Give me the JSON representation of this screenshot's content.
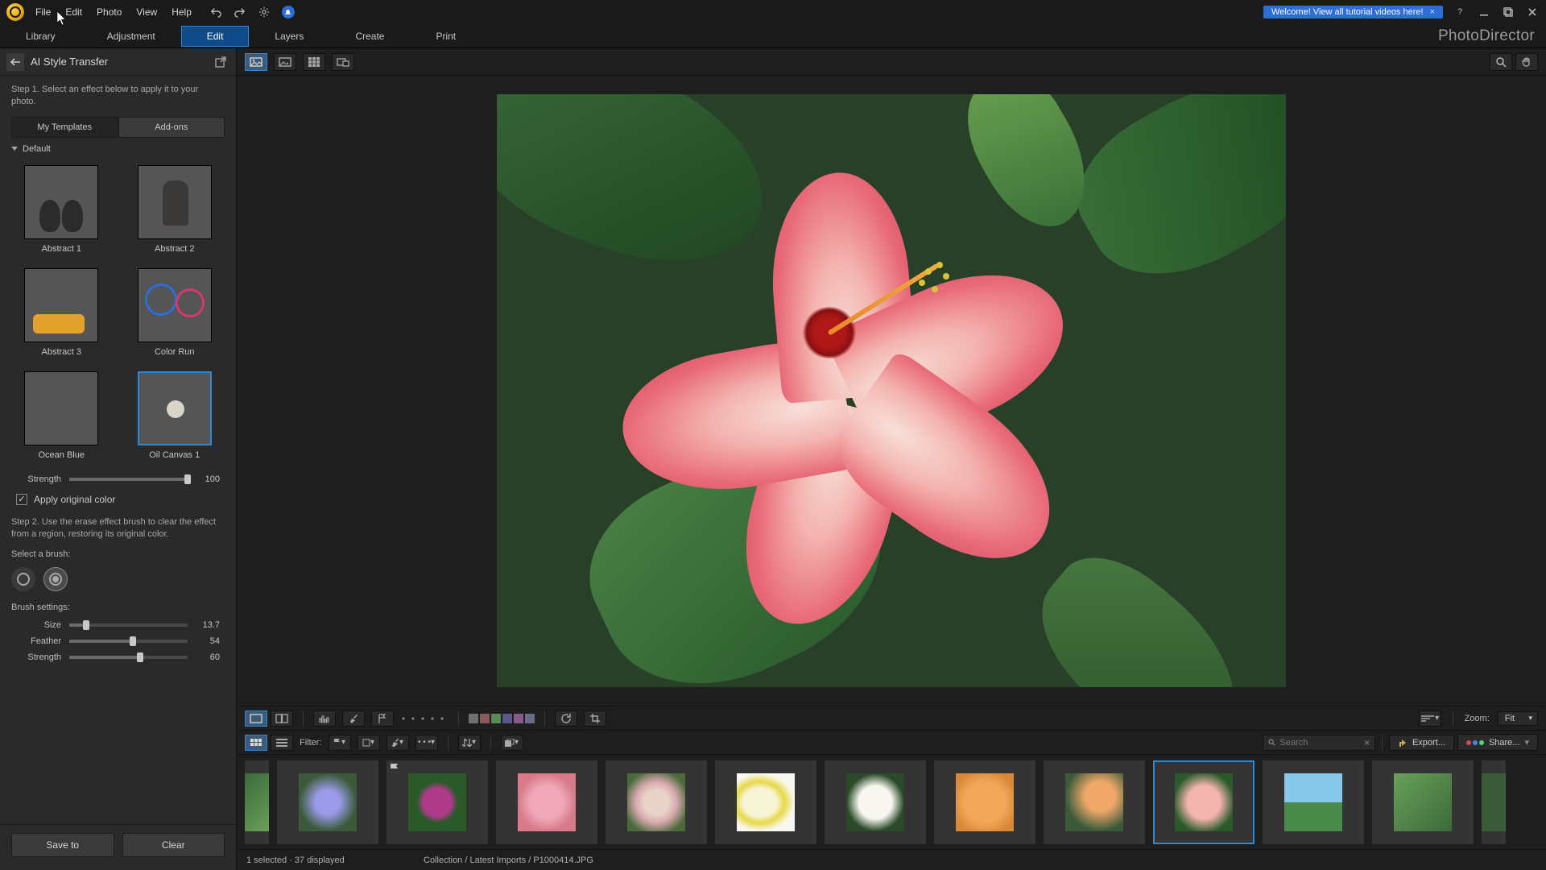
{
  "titlebar": {
    "menu": [
      "File",
      "Edit",
      "Photo",
      "View",
      "Help"
    ],
    "welcome_text": "Welcome! View all tutorial videos here!"
  },
  "mode_tabs": [
    "Library",
    "Adjustment",
    "Edit",
    "Layers",
    "Create",
    "Print"
  ],
  "mode_active": "Edit",
  "brand": "PhotoDirector",
  "sidebar": {
    "title": "AI Style Transfer",
    "step1": "Step 1. Select an effect below to apply it to your photo.",
    "template_tabs": [
      "My Templates",
      "Add-ons"
    ],
    "template_tab_active": "My Templates",
    "section": "Default",
    "templates": [
      {
        "label": "Abstract 1",
        "cls": "t-shoes"
      },
      {
        "label": "Abstract 2",
        "cls": "t-man"
      },
      {
        "label": "Abstract 3",
        "cls": "t-car"
      },
      {
        "label": "Color Run",
        "cls": "t-run"
      },
      {
        "label": "Ocean Blue",
        "cls": "t-ocean"
      },
      {
        "label": "Oil Canvas 1",
        "cls": "t-oil",
        "selected": true
      }
    ],
    "strength_label": "Strength",
    "strength_value": "100",
    "apply_original_color": "Apply original color",
    "step2": "Step 2. Use the erase effect brush to clear the effect from a region, restoring its original color.",
    "select_brush": "Select a brush:",
    "brush_settings": "Brush settings:",
    "brush": {
      "size_label": "Size",
      "size_value": "13.7",
      "feather_label": "Feather",
      "feather_value": "54",
      "strength_label": "Strength",
      "strength_value": "60"
    },
    "save_to": "Save to",
    "clear": "Clear"
  },
  "lower_toolbar": {
    "zoom_label": "Zoom:",
    "zoom_value": "Fit",
    "swatches": [
      "#707070",
      "#8a5a5a",
      "#5a8a5a",
      "#5a5a8a",
      "#8a5a8a",
      "#6a6a8a"
    ]
  },
  "filter_bar": {
    "filter_label": "Filter:",
    "search_placeholder": "Search",
    "export_label": "Export...",
    "share_label": "Share..."
  },
  "filmstrip": {
    "selected_index": 9
  },
  "status": {
    "selection": "1 selected · 37 displayed",
    "path": "Collection / Latest Imports / P1000414.JPG"
  }
}
